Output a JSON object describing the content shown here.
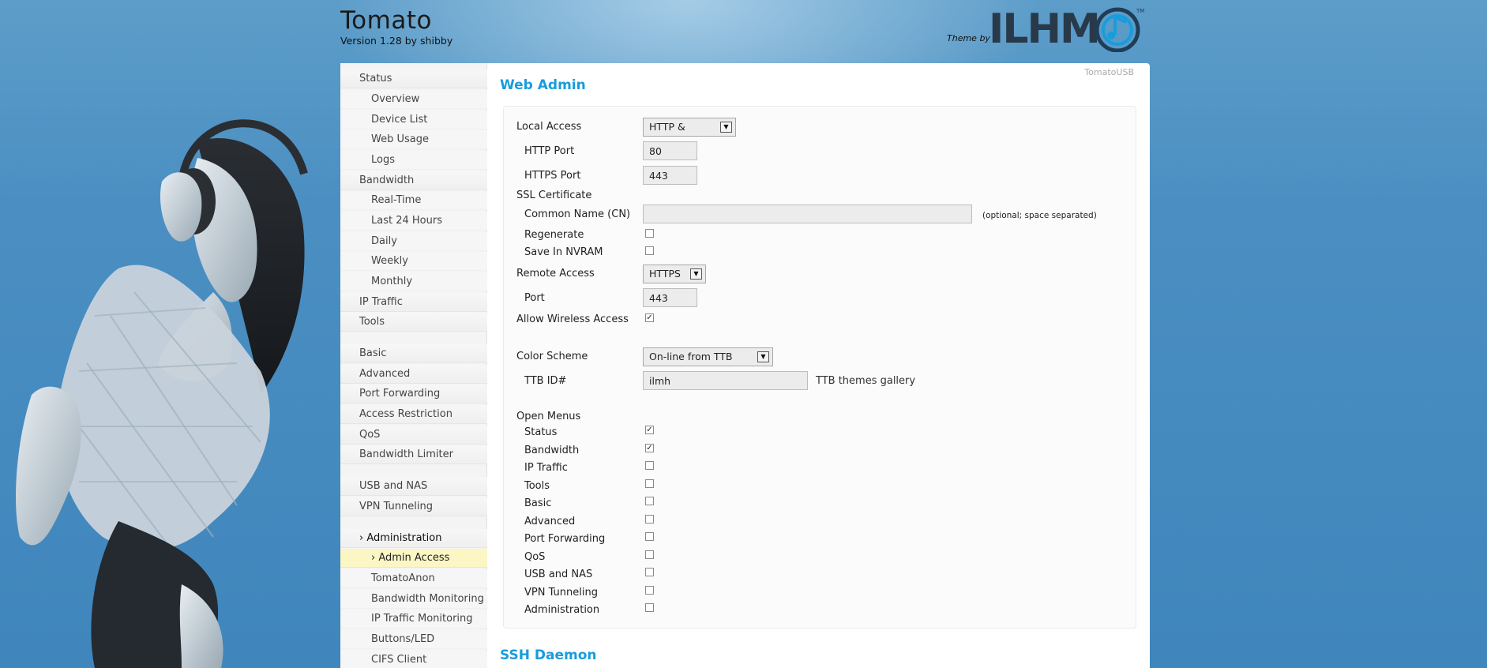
{
  "header": {
    "title": "Tomato",
    "version": "Version 1.28 by shibby",
    "theme_by": "Theme by",
    "logo_text": "ILHM",
    "logo_mark": "TM"
  },
  "corner_label": "TomatoUSB",
  "sidebar": {
    "items": [
      {
        "label": "Status",
        "level": "top"
      },
      {
        "label": "Overview",
        "level": "sub"
      },
      {
        "label": "Device List",
        "level": "sub"
      },
      {
        "label": "Web Usage",
        "level": "sub"
      },
      {
        "label": "Logs",
        "level": "sub"
      },
      {
        "label": "Bandwidth",
        "level": "top"
      },
      {
        "label": "Real-Time",
        "level": "sub"
      },
      {
        "label": "Last 24 Hours",
        "level": "sub"
      },
      {
        "label": "Daily",
        "level": "sub"
      },
      {
        "label": "Weekly",
        "level": "sub"
      },
      {
        "label": "Monthly",
        "level": "sub"
      },
      {
        "label": "IP Traffic",
        "level": "top"
      },
      {
        "label": "Tools",
        "level": "top"
      },
      {
        "label": "Basic",
        "level": "top"
      },
      {
        "label": "Advanced",
        "level": "top"
      },
      {
        "label": "Port Forwarding",
        "level": "top"
      },
      {
        "label": "Access Restriction",
        "level": "top"
      },
      {
        "label": "QoS",
        "level": "top"
      },
      {
        "label": "Bandwidth Limiter",
        "level": "top"
      },
      {
        "label": "USB and NAS",
        "level": "top"
      },
      {
        "label": "VPN Tunneling",
        "level": "top"
      },
      {
        "label": "› Administration",
        "level": "top"
      },
      {
        "label": "› Admin Access",
        "level": "sub"
      },
      {
        "label": "TomatoAnon",
        "level": "sub"
      },
      {
        "label": "Bandwidth Monitoring",
        "level": "sub"
      },
      {
        "label": "IP Traffic Monitoring",
        "level": "sub"
      },
      {
        "label": "Buttons/LED",
        "level": "sub"
      },
      {
        "label": "CIFS Client",
        "level": "sub"
      }
    ]
  },
  "web_admin": {
    "title": "Web Admin",
    "local_access_label": "Local Access",
    "local_access_value": "HTTP &",
    "http_port_label": "HTTP Port",
    "http_port_value": "80",
    "https_port_label": "HTTPS Port",
    "https_port_value": "443",
    "ssl_cert_label": "SSL Certificate",
    "common_name_label": "Common Name (CN)",
    "common_name_value": "",
    "common_name_hint": "(optional; space separated)",
    "regenerate_label": "Regenerate",
    "regenerate_checked": false,
    "save_nvram_label": "Save In NVRAM",
    "save_nvram_checked": false,
    "remote_access_label": "Remote Access",
    "remote_access_value": "HTTPS",
    "port_label": "Port",
    "port_value": "443",
    "allow_wireless_label": "Allow Wireless Access",
    "allow_wireless_checked": true,
    "color_scheme_label": "Color Scheme",
    "color_scheme_value": "On-line from TTB",
    "ttb_id_label": "TTB ID#",
    "ttb_id_value": "ilmh",
    "ttb_gallery": "TTB themes gallery",
    "open_menus_label": "Open Menus",
    "open_menus": [
      {
        "label": "Status",
        "checked": true
      },
      {
        "label": "Bandwidth",
        "checked": true
      },
      {
        "label": "IP Traffic",
        "checked": false
      },
      {
        "label": "Tools",
        "checked": false
      },
      {
        "label": "Basic",
        "checked": false
      },
      {
        "label": "Advanced",
        "checked": false
      },
      {
        "label": "Port Forwarding",
        "checked": false
      },
      {
        "label": "QoS",
        "checked": false
      },
      {
        "label": "USB and NAS",
        "checked": false
      },
      {
        "label": "VPN Tunneling",
        "checked": false
      },
      {
        "label": "Administration",
        "checked": false
      }
    ]
  },
  "ssh_daemon": {
    "title": "SSH Daemon"
  },
  "colors": {
    "accent": "#1a9cdb",
    "active_nav": "#fbf6c4",
    "background": "#4b8fc2"
  }
}
